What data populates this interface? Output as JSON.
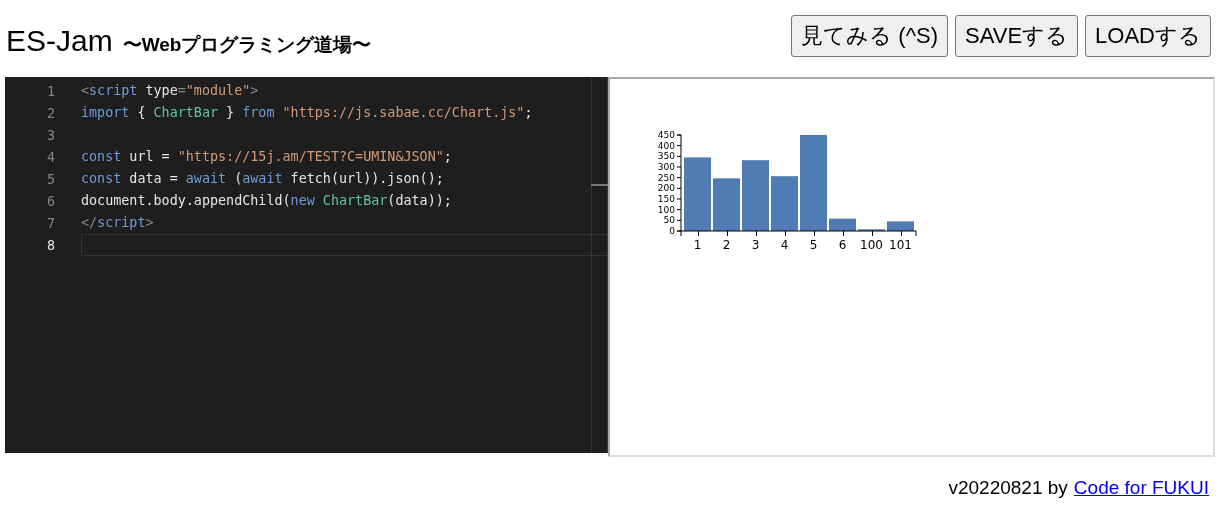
{
  "header": {
    "title": "ES-Jam",
    "subtitle": "〜Webプログラミング道場〜"
  },
  "buttons": [
    {
      "label": "見てみる (^S)"
    },
    {
      "label": "SAVEする"
    },
    {
      "label": "LOADする"
    }
  ],
  "editor": {
    "lines": [
      {
        "number": "1",
        "active": false,
        "tokens": [
          {
            "kind": "punct",
            "text": "<"
          },
          {
            "kind": "tag",
            "text": "script"
          },
          {
            "kind": "plain",
            "text": " type"
          },
          {
            "kind": "punct",
            "text": "="
          },
          {
            "kind": "string",
            "text": "\"module\""
          },
          {
            "kind": "punct",
            "text": ">"
          }
        ]
      },
      {
        "number": "2",
        "active": false,
        "tokens": [
          {
            "kind": "keyword",
            "text": "import"
          },
          {
            "kind": "plain",
            "text": " { "
          },
          {
            "kind": "class",
            "text": "ChartBar"
          },
          {
            "kind": "plain",
            "text": " } "
          },
          {
            "kind": "keyword",
            "text": "from"
          },
          {
            "kind": "string",
            "text": " \"https://js.sabae.cc/Chart.js\""
          },
          {
            "kind": "plain",
            "text": ";"
          }
        ]
      },
      {
        "number": "3",
        "active": false
      },
      {
        "number": "4",
        "active": false,
        "tokens": [
          {
            "kind": "keyword",
            "text": "const"
          },
          {
            "kind": "plain",
            "text": " url = "
          },
          {
            "kind": "string",
            "text": "\"https://15j.am/TEST?C=UMIN&JSON\""
          },
          {
            "kind": "plain",
            "text": ";"
          }
        ]
      },
      {
        "number": "5",
        "active": false,
        "tokens": [
          {
            "kind": "keyword",
            "text": "const"
          },
          {
            "kind": "plain",
            "text": " data = "
          },
          {
            "kind": "keyword",
            "text": "await"
          },
          {
            "kind": "plain",
            "text": " ("
          },
          {
            "kind": "keyword",
            "text": "await"
          },
          {
            "kind": "plain",
            "text": " fetch(url)).json();"
          }
        ]
      },
      {
        "number": "6",
        "active": false,
        "tokens": [
          {
            "kind": "plain",
            "text": "document.body.appendChild("
          },
          {
            "kind": "keyword",
            "text": "new"
          },
          {
            "kind": "class",
            "text": " ChartBar"
          },
          {
            "kind": "plain",
            "text": "(data));"
          }
        ]
      },
      {
        "number": "7",
        "active": false,
        "tokens": [
          {
            "kind": "punct",
            "text": "</"
          },
          {
            "kind": "tag",
            "text": "script"
          },
          {
            "kind": "punct",
            "text": ">"
          }
        ]
      },
      {
        "number": "8",
        "active": true
      }
    ]
  },
  "preview": {
    "chart_data": {
      "type": "bar",
      "categories": [
        "1",
        "2",
        "3",
        "4",
        "5",
        "6",
        "100",
        "101"
      ],
      "values": [
        345,
        247,
        332,
        257,
        450,
        58,
        8,
        45
      ],
      "ylim": [
        0,
        450
      ],
      "yticks": [
        0,
        50,
        100,
        150,
        200,
        250,
        300,
        350,
        400,
        450
      ]
    }
  },
  "footer": {
    "version": "v20220821 by",
    "link": "Code for FUKUI"
  }
}
